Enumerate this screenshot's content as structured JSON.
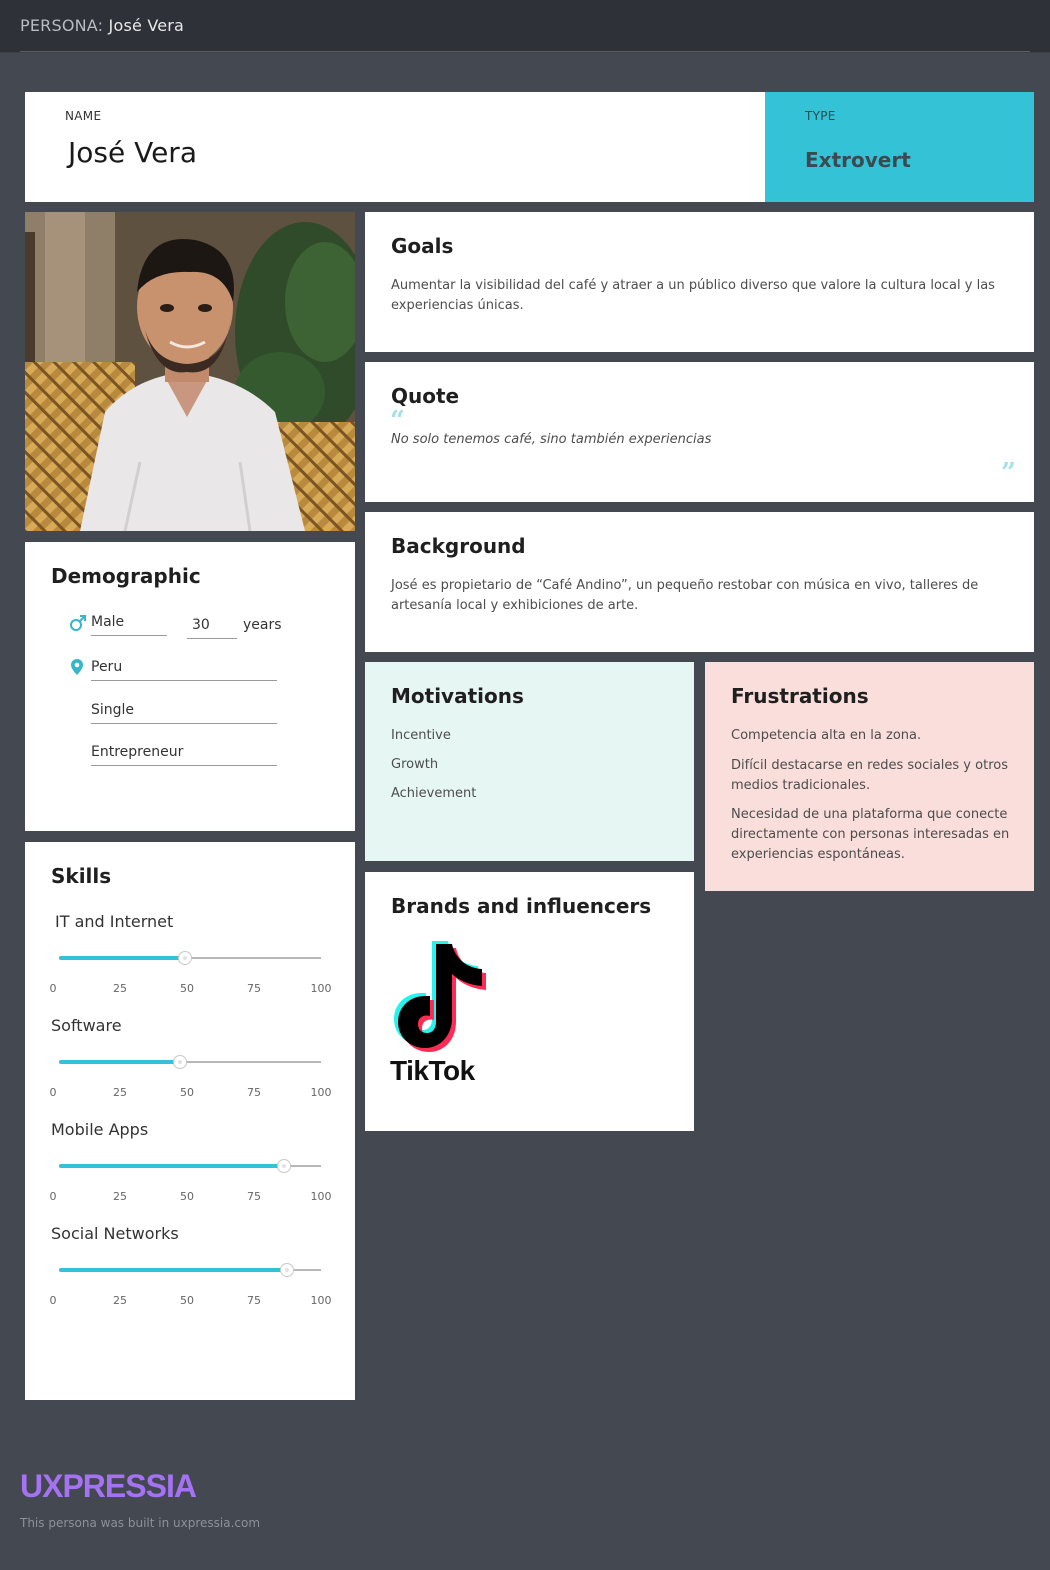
{
  "header": {
    "prefix": "PERSONA:",
    "name": "José Vera"
  },
  "name_card": {
    "label": "NAME",
    "value": "José Vera"
  },
  "type_card": {
    "label": "TYPE",
    "value": "Extrovert"
  },
  "goals": {
    "title": "Goals",
    "text": "Aumentar la visibilidad del café y atraer a un público diverso que valore la cultura local y las experiencias únicas."
  },
  "quote": {
    "title": "Quote",
    "text": "No solo tenemos café, sino también experiencias",
    "open_mark": "“",
    "close_mark": "”"
  },
  "background": {
    "title": "Background",
    "text": "José es propietario de “Café Andino”, un pequeño restobar con música en vivo, talleres de artesanía local y exhibiciones de arte."
  },
  "demographic": {
    "title": "Demographic",
    "gender": "Male",
    "gender_icon": "male-icon",
    "age": "30",
    "age_unit": "years",
    "location": "Peru",
    "location_icon": "location-pin-icon",
    "status": "Single",
    "occupation": "Entrepreneur"
  },
  "motivations": {
    "title": "Motivations",
    "items": [
      "Incentive",
      "Growth",
      "Achievement"
    ]
  },
  "frustrations": {
    "title": "Frustrations",
    "items": [
      "Competencia alta en la zona.",
      "Difícil destacarse en redes sociales y otros medios tradicionales.",
      "Necesidad de una plataforma que conecte directamente con personas interesadas en experiencias espontáneas."
    ]
  },
  "brands": {
    "title": "Brands and influencers",
    "logo_text": "TikTok"
  },
  "skills": {
    "title": "Skills",
    "ticks": [
      "0",
      "25",
      "50",
      "75",
      "100"
    ],
    "items": [
      {
        "label": "IT and Internet",
        "value": 48
      },
      {
        "label": "Software",
        "value": 46
      },
      {
        "label": "Mobile Apps",
        "value": 86
      },
      {
        "label": "Social Networks",
        "value": 87
      }
    ]
  },
  "colors": {
    "accent": "#34c2d6",
    "brand": "#a472f2",
    "motivations_bg": "#e6f7f3",
    "frustrations_bg": "#f9dedb"
  },
  "footer": {
    "logo": "UXPRESSIA",
    "note": "This persona was built in uxpressia.com"
  }
}
